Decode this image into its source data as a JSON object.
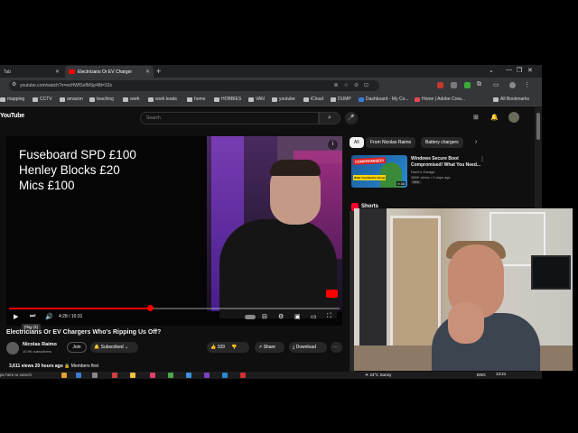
{
  "browser": {
    "tabs": [
      {
        "label": "Tab"
      },
      {
        "label": "Electricians Or EV Charger"
      }
    ],
    "url": "youtube.com/watch?v=esHWfSefMSp48t=32s",
    "bookmarks": [
      {
        "label": "mapping"
      },
      {
        "label": "CCTV"
      },
      {
        "label": "amazon"
      },
      {
        "label": "teaching"
      },
      {
        "label": "work"
      },
      {
        "label": "work leads"
      },
      {
        "label": "home"
      },
      {
        "label": "HOBBIES"
      },
      {
        "label": "VAN"
      },
      {
        "label": "youtube"
      },
      {
        "label": "iCloud"
      },
      {
        "label": "DUMP"
      },
      {
        "label": "Dashboard - My Co..."
      },
      {
        "label": "Home | Adobe Crea..."
      },
      {
        "label": "All Bookmarks"
      }
    ]
  },
  "youtube": {
    "logo": "YouTube",
    "search_placeholder": "Search",
    "player": {
      "overlay_lines": [
        "Fuseboard SPD £100",
        "Henley Blocks £20",
        "Mics £100"
      ],
      "time": "4:28 / 10:31",
      "progress_fraction": 0.426,
      "tooltip": "Play (k)"
    },
    "video": {
      "title": "Electricians Or EV Chargers Who's Ripping Us Off?",
      "channel": "Nicolas Raimo",
      "subscribers": "10.9K subscribers",
      "join_label": "Join",
      "subscribed_label": "Subscribed",
      "likes": "109",
      "share_label": "Share",
      "download_label": "Download",
      "views": "3,611 views",
      "age": "20 hours ago",
      "members": "Members first"
    },
    "chips": [
      {
        "label": "All",
        "active": true
      },
      {
        "label": "From Nicolas Raimo",
        "active": false
      },
      {
        "label": "Battery chargers",
        "active": false
      }
    ],
    "recommendation": {
      "badge": "COMPROMISED!",
      "thumb_tag": "What You Need to Know",
      "duration": "9:38",
      "title": "Windows Secure Boot Compromised! What You Need...",
      "channel": "Dave's Garage",
      "meta": "386K views • 2 days ago",
      "new_badge": "New"
    },
    "shorts_label": "Shorts"
  },
  "taskbar": {
    "search_text": "pe here to search",
    "weather": "24°C Sunny",
    "language": "ENG",
    "clock": "13:21"
  },
  "colors": {
    "accent": "#ff0000",
    "background": "#0f0f0f"
  }
}
